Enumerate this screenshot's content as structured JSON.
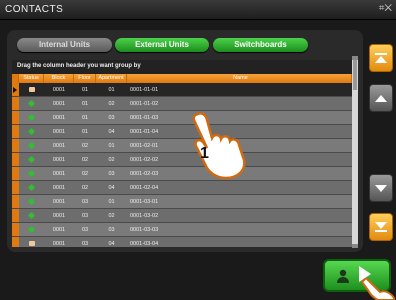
{
  "window": {
    "title": "CONTACTS",
    "corner_icon": "minimize-icon"
  },
  "tabs": [
    {
      "label": "Internal Units",
      "active": true
    },
    {
      "label": "External Units",
      "active": false
    },
    {
      "label": "Switchboards",
      "active": false
    }
  ],
  "grid": {
    "group_hint": "Drag the column header you want group by",
    "columns": [
      "Status",
      "Block",
      "Floor",
      "Apartment",
      "Name"
    ],
    "rows": [
      {
        "status": "active-rect",
        "block": "0001",
        "floor": "01",
        "apt": "01",
        "name": "0001-01-01",
        "selected": true
      },
      {
        "status": "green-arrow",
        "block": "0001",
        "floor": "01",
        "apt": "02",
        "name": "0001-01-02"
      },
      {
        "status": "green-arrow",
        "block": "0001",
        "floor": "01",
        "apt": "03",
        "name": "0001-01-03"
      },
      {
        "status": "green-arrow",
        "block": "0001",
        "floor": "01",
        "apt": "04",
        "name": "0001-01-04"
      },
      {
        "status": "green-arrow",
        "block": "0001",
        "floor": "02",
        "apt": "01",
        "name": "0001-02-01"
      },
      {
        "status": "green-arrow",
        "block": "0001",
        "floor": "02",
        "apt": "02",
        "name": "0001-02-02"
      },
      {
        "status": "green-arrow",
        "block": "0001",
        "floor": "02",
        "apt": "03",
        "name": "0001-02-03"
      },
      {
        "status": "green-arrow",
        "block": "0001",
        "floor": "02",
        "apt": "04",
        "name": "0001-02-04"
      },
      {
        "status": "green-arrow",
        "block": "0001",
        "floor": "03",
        "apt": "01",
        "name": "0001-03-01"
      },
      {
        "status": "green-arrow",
        "block": "0001",
        "floor": "03",
        "apt": "02",
        "name": "0001-03-02"
      },
      {
        "status": "green-arrow",
        "block": "0001",
        "floor": "03",
        "apt": "03",
        "name": "0001-03-03"
      },
      {
        "status": "active-rect",
        "block": "0001",
        "floor": "03",
        "apt": "04",
        "name": "0001-03-04"
      }
    ]
  },
  "callout": {
    "number": "1"
  },
  "colors": {
    "accent_orange": "#e07a10",
    "accent_green": "#2fbf2f"
  }
}
